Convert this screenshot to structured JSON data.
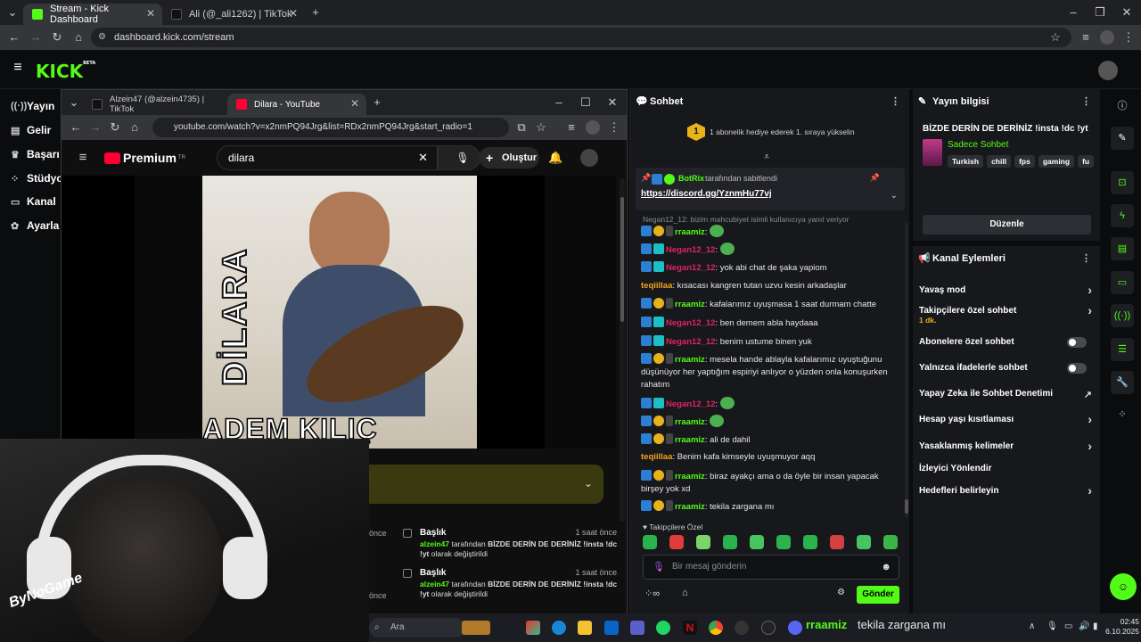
{
  "browser": {
    "tabs": [
      {
        "label": "Stream - Kick Dashboard"
      },
      {
        "label": "Ali (@_ali1262) | TikTok"
      }
    ],
    "url": "dashboard.kick.com/stream"
  },
  "kick": {
    "logo": "KICK",
    "logo_sup": "BETA",
    "sidenav": [
      {
        "label": "Yayın",
        "icon": "broadcast-icon"
      },
      {
        "label": "Gelir",
        "icon": "money-icon"
      },
      {
        "label": "Başarı",
        "icon": "trophy-icon"
      },
      {
        "label": "Stüdyo",
        "icon": "studio-icon"
      },
      {
        "label": "Kanal",
        "icon": "channel-icon"
      },
      {
        "label": "Ayarla",
        "icon": "gear-icon"
      }
    ]
  },
  "youtube_window": {
    "tabs": [
      {
        "label": "Alzein47 (@alzein4735) | TikTok"
      },
      {
        "label": "Dilara - YouTube"
      }
    ],
    "url": "youtube.com/watch?v=x2nmPQ94Jrg&list=RDx2nmPQ94Jrg&start_radio=1",
    "logo": "Premium",
    "logo_sup": "TR",
    "search_value": "dilara",
    "create_label": "Oluştur",
    "thumbnail_title": "DİLARA",
    "thumbnail_artist": "ADEM KILIÇ"
  },
  "title_feed": [
    {
      "heading": "Başlık",
      "time": "1 saat önce",
      "user": "alzein47",
      "mid": "tarafından",
      "title": "BİZDE DERİN DE DERİNİZ !insta !dc !yt",
      "suffix": "olarak değiştirildi"
    },
    {
      "heading": "Başlık",
      "time": "1 saat önce",
      "user": "alzein47",
      "mid": "tarafından",
      "title": "BİZDE DERİN DE DERİNİZ !insta !dc !yt",
      "suffix": "olarak değiştirildi"
    }
  ],
  "feed_side_labels": [
    "önce",
    "önce"
  ],
  "webcam_overlay": "ByNoGame",
  "chat": {
    "title": "Sohbet",
    "gift_goal": "1 abonelik hediye ederek 1. sıraya yükselin",
    "gift_rank": "1",
    "pinned_user": "BotRix",
    "pinned_by": "tarafından sabitlendi",
    "pinned_link": "https://discord.gg/YznmHu77vj",
    "reply_note": "Negan12_12: bizim mahcubiyet isimli kullanıcıya yanıt veriyor",
    "messages": [
      {
        "user": "rraamiz",
        "color": "#53fc18",
        "text": "",
        "emote": true
      },
      {
        "user": "Negan12_12",
        "color": "#e0245e",
        "text": "",
        "emote": true
      },
      {
        "user": "Negan12_12",
        "color": "#e0245e",
        "text": "yok abi chat de şaka yapiom"
      },
      {
        "user": "teqiillaa",
        "color": "#f6a41c",
        "text": "kısacası kangren tutan uzvu kesin arkadaşlar"
      },
      {
        "user": "rraamiz",
        "color": "#53fc18",
        "text": "kafalarımız uyuşmasa 1 saat durmam chatte"
      },
      {
        "user": "Negan12_12",
        "color": "#e0245e",
        "text": "ben demem abla haydaaa"
      },
      {
        "user": "Negan12_12",
        "color": "#e0245e",
        "text": "benim ustume binen yuk"
      },
      {
        "user": "rraamiz",
        "color": "#53fc18",
        "text": "mesela hande ablayla kafalarımız uyuştuğunu düşünüyor her yaptığım espiriyi anlıyor o yüzden onla konuşurken rahatım"
      },
      {
        "user": "Negan12_12",
        "color": "#e0245e",
        "text": "",
        "emote": true
      },
      {
        "user": "rraamiz",
        "color": "#53fc18",
        "text": "",
        "emote": true
      },
      {
        "user": "rraamiz",
        "color": "#53fc18",
        "text": "ali de dahil"
      },
      {
        "user": "teqiillaa",
        "color": "#f6a41c",
        "text": "Benim kafa kimseyle uyuşmuyor aqq"
      },
      {
        "user": "rraamiz",
        "color": "#53fc18",
        "text": "biraz ayakçı ama o da öyle bir insan yapacak birşey yok xd"
      },
      {
        "user": "rraamiz",
        "color": "#53fc18",
        "text": "tekila zargana mı"
      }
    ],
    "follower_only": "Takipçilere Özel",
    "input_placeholder": "Bir mesaj gönderin",
    "send_label": "Gönder"
  },
  "stream_info": {
    "title": "Yayın bilgisi",
    "stream_title": "BİZDE DERİN DE DERİNİZ !insta !dc !yt",
    "category": "Sadece Sohbet",
    "tags": [
      "Turkish",
      "chill",
      "fps",
      "gaming",
      "fu"
    ],
    "edit_label": "Düzenle"
  },
  "channel_actions": {
    "title": "Kanal Eylemleri",
    "items": [
      {
        "label": "Yavaş mod",
        "control": "chevron"
      },
      {
        "label": "Takipçilere özel sohbet",
        "sub": "1 dk.",
        "control": "chevron"
      },
      {
        "label": "Abonelere özel sohbet",
        "control": "toggle"
      },
      {
        "label": "Yalnızca ifadelerle sohbet",
        "control": "toggle"
      },
      {
        "label": "Yapay Zeka ile Sohbet Denetimi",
        "control": "external"
      },
      {
        "label": "Hesap yaşı kısıtlaması",
        "control": "chevron"
      },
      {
        "label": "Yasaklanmış kelimeler",
        "control": "chevron"
      },
      {
        "label": "İzleyici Yönlendir",
        "control": "none"
      },
      {
        "label": "Hedefleri belirleyin",
        "control": "chevron"
      }
    ]
  },
  "taskbar": {
    "search_placeholder": "Ara",
    "tray_user": "rraamiz",
    "tray_text": "tekila zargana mı",
    "time": "02:45",
    "date": "6.10.2025"
  },
  "colors": {
    "kick_green": "#53fc18",
    "panel_bg": "#17181c",
    "page_bg": "#0b0c0e"
  }
}
